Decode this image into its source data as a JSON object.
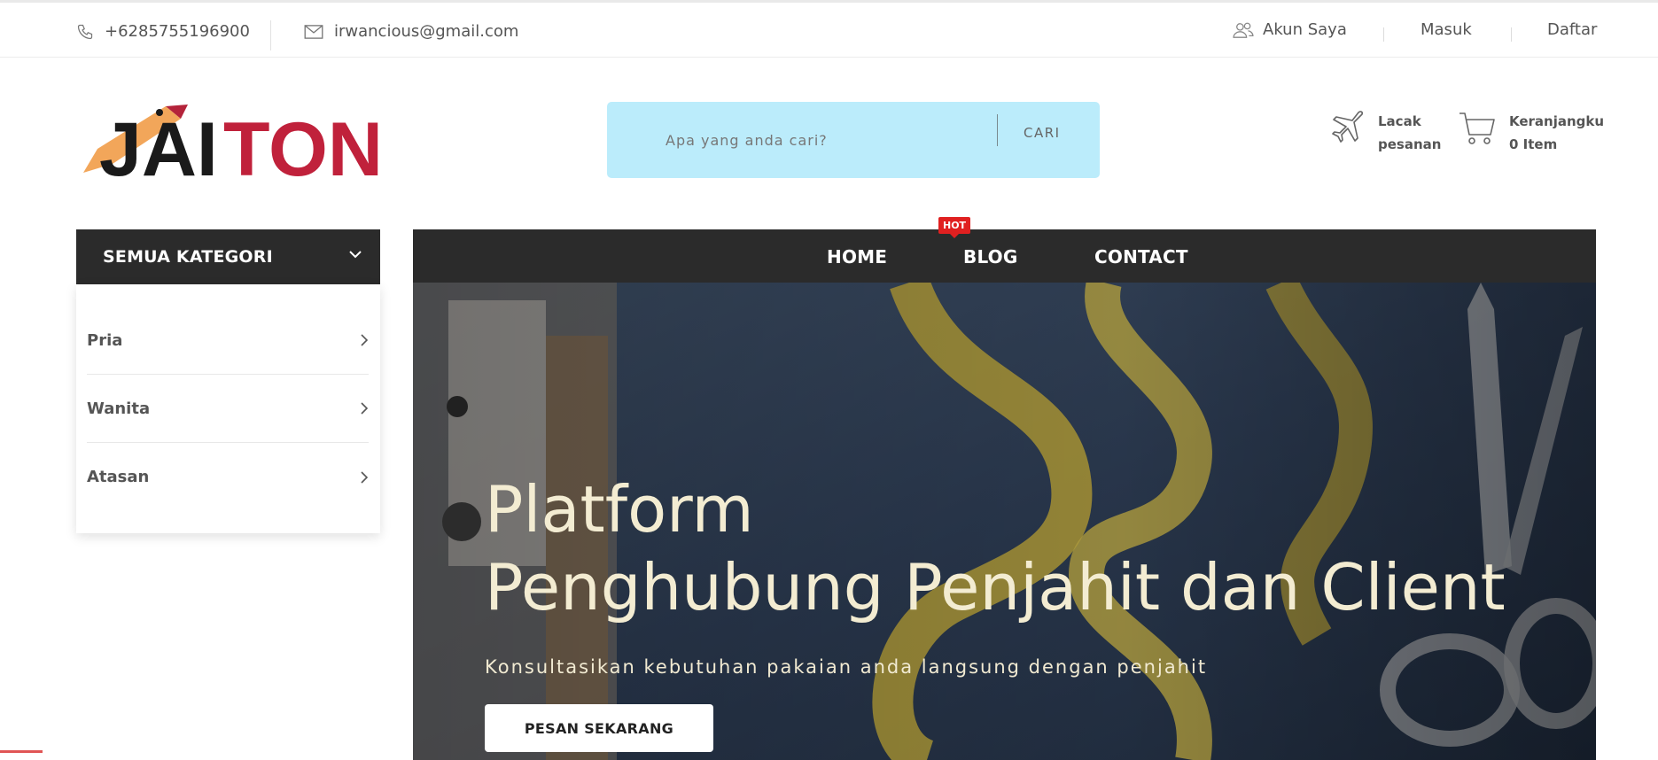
{
  "topbar": {
    "phone": "+6285755196900",
    "email": "irwancious@gmail.com",
    "account": "Akun Saya",
    "login": "Masuk",
    "register": "Daftar"
  },
  "brand": {
    "logo_text_dark": "JAI",
    "logo_text_red": "TON",
    "colors": {
      "red": "#c0213b",
      "dark": "#1a1a1a",
      "pencil": "#f2a65a"
    }
  },
  "search": {
    "placeholder": "Apa yang anda cari?",
    "button": "CARI"
  },
  "header_actions": {
    "track_line1": "Lacak",
    "track_line2": "pesanan",
    "cart_line1": "Keranjangku",
    "cart_line2": "0 Item"
  },
  "categories": {
    "title": "SEMUA KATEGORI",
    "items": [
      {
        "label": "Pria"
      },
      {
        "label": "Wanita"
      },
      {
        "label": "Atasan"
      }
    ]
  },
  "nav": {
    "items": [
      {
        "label": "HOME"
      },
      {
        "label": "BLOG"
      },
      {
        "label": "CONTACT"
      }
    ],
    "hot_badge": "HOT"
  },
  "hero": {
    "title_line1": "Platform",
    "title_line2": "Penghubung Penjahit dan Client",
    "subtitle": "Konsultasikan kebutuhan pakaian anda langsung dengan penjahit",
    "cta": "PESAN SEKARANG"
  }
}
